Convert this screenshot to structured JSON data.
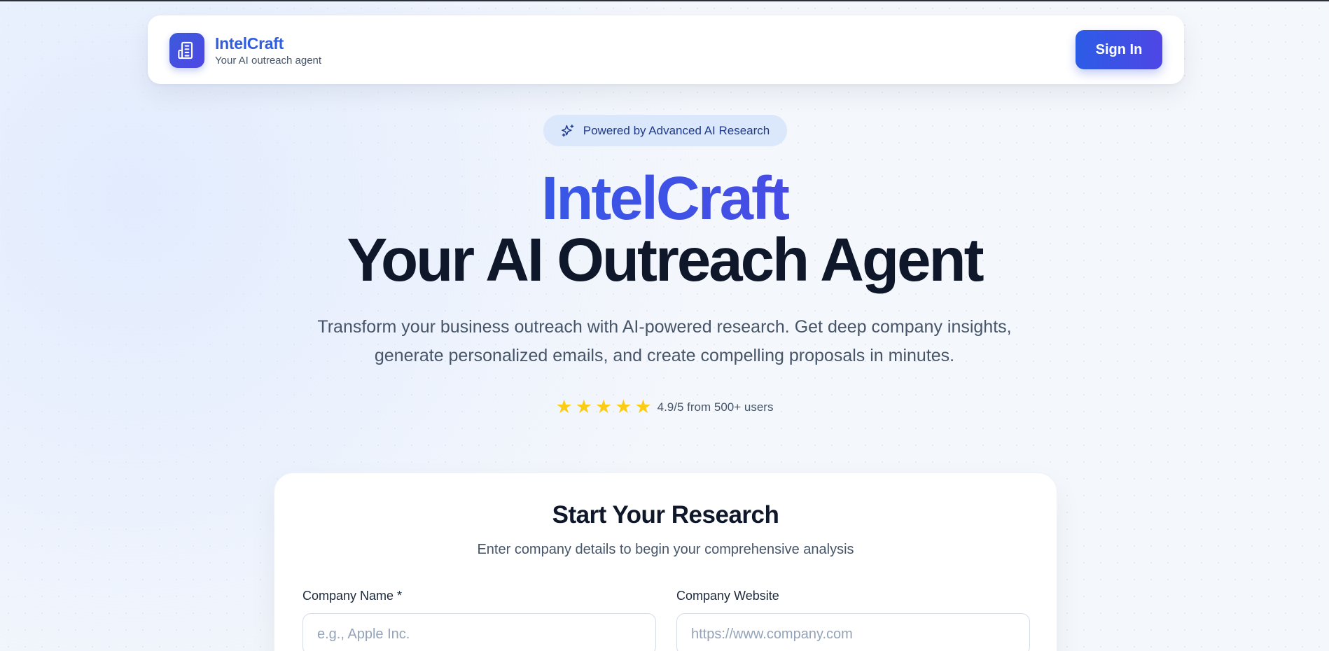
{
  "header": {
    "brand_name": "IntelCraft",
    "brand_tagline": "Your AI outreach agent",
    "signin_label": "Sign In"
  },
  "hero": {
    "badge_text": "Powered by Advanced AI Research",
    "brand_heading": "IntelCraft",
    "title": "Your AI Outreach Agent",
    "description": "Transform your business outreach with AI-powered research. Get deep company insights, generate personalized emails, and create compelling proposals in minutes.",
    "rating": {
      "stars": 5,
      "text": "4.9/5 from 500+ users"
    }
  },
  "research_form": {
    "title": "Start Your Research",
    "subtitle": "Enter company details to begin your comprehensive analysis",
    "company_name": {
      "label": "Company Name *",
      "placeholder": "e.g., Apple Inc.",
      "value": ""
    },
    "company_website": {
      "label": "Company Website",
      "placeholder": "https://www.company.com",
      "value": ""
    }
  },
  "icons": {
    "brand_logo": "building-icon",
    "badge": "sparkles-icon",
    "rating": "star-icon"
  },
  "colors": {
    "accent": "#2f5ce0",
    "accent_secondary": "#4f46e5",
    "star": "#facc15",
    "badge_bg": "#dbe7fb"
  }
}
